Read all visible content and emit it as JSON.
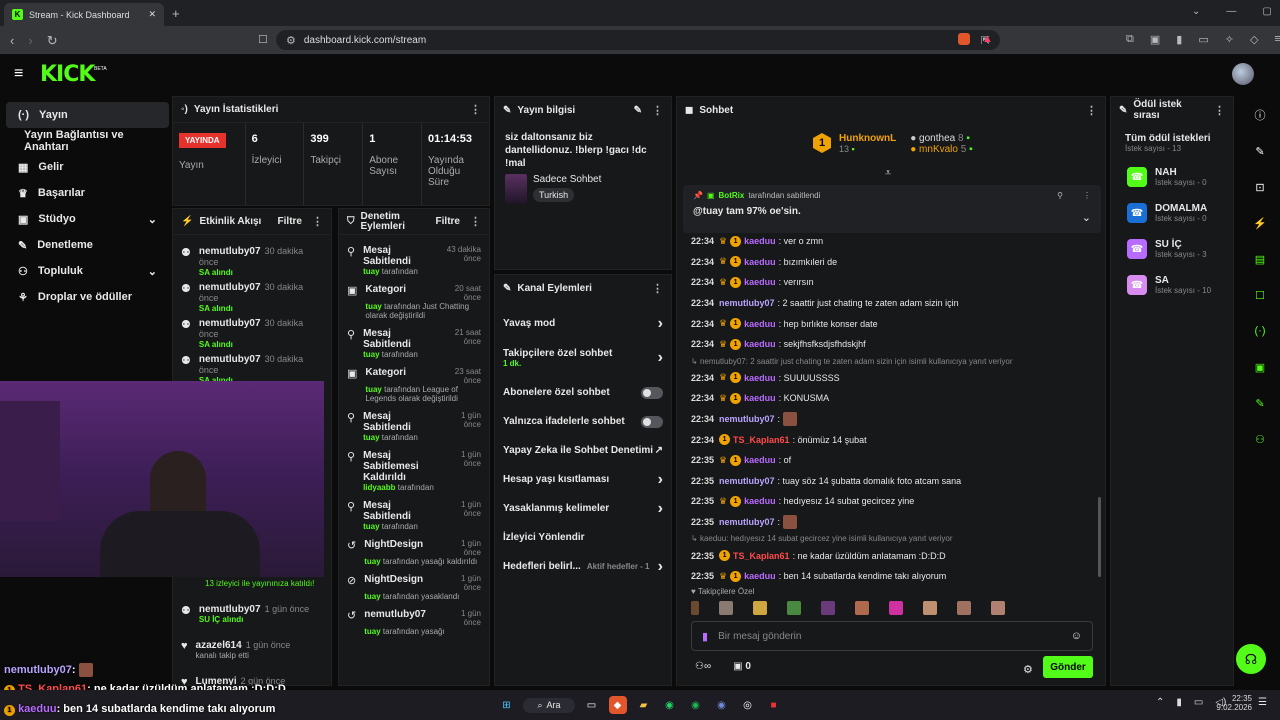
{
  "browser": {
    "tab_title": "Stream - Kick Dashboard",
    "url": "dashboard.kick.com/stream"
  },
  "sidebar": {
    "items": [
      {
        "label": "Yayın",
        "icon": "stream-icon"
      },
      {
        "label": "Yayın Bağlantısı ve Anahtarı",
        "icon": ""
      },
      {
        "label": "Gelir",
        "icon": "revenue-icon"
      },
      {
        "label": "Başarılar",
        "icon": "trophy-icon"
      },
      {
        "label": "Stüdyo",
        "icon": "studio-icon"
      },
      {
        "label": "Denetleme",
        "icon": "wrench-icon"
      },
      {
        "label": "Topluluk",
        "icon": "community-icon"
      },
      {
        "label": "Droplar ve ödüller",
        "icon": "drops-icon"
      }
    ]
  },
  "stats": {
    "title": "Yayın İstatistikleri",
    "live_badge": "YAYINDA",
    "live_label": "Yayın",
    "viewers": "6",
    "viewers_label": "İzleyici",
    "followers": "399",
    "followers_label": "Takipçi",
    "subs": "1",
    "subs_label": "Abone Sayısı",
    "uptime": "01:14:53",
    "uptime_label": "Yayında Olduğu Süre"
  },
  "info": {
    "title": "Yayın bilgisi",
    "stream_title": "siz daltonsanız biz dantellidonuz. !blerp !gacı !dc !mal",
    "category": "Sadece Sohbet",
    "language": "Turkish"
  },
  "activity": {
    "title": "Etkinlik Akışı",
    "filter": "Filtre",
    "items": [
      {
        "name": "nemutluby07",
        "time": "30 dakika önce",
        "sub": "SA alındı"
      },
      {
        "name": "nemutluby07",
        "time": "30 dakika önce",
        "sub": "SA alındı"
      },
      {
        "name": "nemutluby07",
        "time": "30 dakika önce",
        "sub": "SA alındı"
      },
      {
        "name": "nemutluby07",
        "time": "30 dakika önce",
        "sub": "SA alındı"
      }
    ],
    "raid_text": "13 izleyici ile yayınınıza katıldı!",
    "items2": [
      {
        "name": "nemutluby07",
        "time": "1 gün önce",
        "sub": "SU İÇ alındı"
      },
      {
        "name": "azazel614",
        "time": "1 gün önce",
        "sub": "kanalı takip etti"
      },
      {
        "name": "Lumenyi",
        "time": "2 gün önce",
        "sub": ""
      }
    ]
  },
  "moderation": {
    "title": "Denetim Eylemleri",
    "filter": "Filtre",
    "items": [
      {
        "title": "Mesaj Sabitlendi",
        "time": "43 dakika önce",
        "by": "tuay",
        "rest": "tarafından"
      },
      {
        "title": "Kategori",
        "time": "20 saat önce",
        "by": "tuay",
        "rest": "tarafından Just Chatting olarak değiştirildi"
      },
      {
        "title": "Mesaj Sabitlendi",
        "time": "21 saat önce",
        "by": "tuay",
        "rest": "tarafından"
      },
      {
        "title": "Kategori",
        "time": "23 saat önce",
        "by": "tuay",
        "rest": "tarafından League of Legends olarak değiştirildi"
      },
      {
        "title": "Mesaj Sabitlendi",
        "time": "1 gün önce",
        "by": "tuay",
        "rest": "tarafından"
      },
      {
        "title": "Mesaj Sabitlemesi Kaldırıldı",
        "time": "1 gün önce",
        "by": "lidyaabb",
        "rest": "tarafından"
      },
      {
        "title": "Mesaj Sabitlendi",
        "time": "1 gün önce",
        "by": "tuay",
        "rest": "tarafından"
      },
      {
        "title": "NightDesign",
        "time": "1 gün önce",
        "by": "tuay",
        "rest": "tarafından yasağı kaldırıldı"
      },
      {
        "title": "NightDesign",
        "time": "1 gün önce",
        "by": "tuay",
        "rest": "tarafından yasaklandı"
      },
      {
        "title": "nemutluby07",
        "time": "1 gün önce",
        "by": "tuay",
        "rest": "tarafından yasağı"
      }
    ]
  },
  "channel": {
    "title": "Kanal Eylemleri",
    "items": [
      {
        "label": "Yavaş mod",
        "type": "chevron"
      },
      {
        "label": "Takipçilere özel sohbet",
        "extra": "1 dk.",
        "type": "chevron"
      },
      {
        "label": "Abonelere özel sohbet",
        "type": "toggle"
      },
      {
        "label": "Yalnızca ifadelerle sohbet",
        "type": "toggle"
      },
      {
        "label": "Yapay Zeka ile Sohbet Denetimi",
        "type": "link"
      },
      {
        "label": "Hesap yaşı kısıtlaması",
        "type": "chevron"
      },
      {
        "label": "Yasaklanmış kelimeler",
        "type": "chevron"
      },
      {
        "label": "İzleyici Yönlendir",
        "type": "none"
      },
      {
        "label": "Hedefleri belirl...",
        "extra": "Aktif hedefler - 1",
        "type": "chevron"
      }
    ]
  },
  "chat": {
    "title": "Sohbet",
    "leaders": [
      {
        "name": "HunknownL",
        "count": "13"
      },
      {
        "name": "gonthea",
        "count": "8"
      },
      {
        "name": "mnKvalo",
        "count": "5"
      }
    ],
    "pinned_by": "BotRix",
    "pinned_rest": "tarafından sabitlendi",
    "pinned_msg": "@tuay tam 97% oe'sin.",
    "messages": [
      {
        "t": "22:34",
        "u": "kaeduu",
        "c": "p",
        "m": ": ver o zmn",
        "b": true
      },
      {
        "t": "22:34",
        "u": "kaeduu",
        "c": "p",
        "m": ": bızımkıleri de",
        "b": true
      },
      {
        "t": "22:34",
        "u": "kaeduu",
        "c": "p",
        "m": ": verırsın",
        "b": true
      },
      {
        "t": "22:34",
        "u": "nemutluby07",
        "c": "b",
        "m": ": 2 saattir just chating te zaten adam sizin için",
        "b": false
      },
      {
        "t": "22:34",
        "u": "kaeduu",
        "c": "p",
        "m": ": hep bırlıkte konser date",
        "b": true
      },
      {
        "t": "22:34",
        "u": "kaeduu",
        "c": "p",
        "m": ": sekjfhsfksdjsfhdskjhf",
        "b": true
      },
      {
        "reply": "nemutluby07: 2 saattir just chating te zaten adam sizin için isimli kullanıcıya yanıt veriyor"
      },
      {
        "t": "22:34",
        "u": "kaeduu",
        "c": "p",
        "m": ": SUUUUSSSS",
        "b": true
      },
      {
        "t": "22:34",
        "u": "kaeduu",
        "c": "p",
        "m": ": KONUSMA",
        "b": true
      },
      {
        "t": "22:34",
        "u": "nemutluby07",
        "c": "b",
        "m": ":",
        "b": false,
        "emote": true
      },
      {
        "t": "22:34",
        "u": "TS_Kaplan61",
        "c": "r",
        "m": ": önümüz 14 şubat",
        "b": true
      },
      {
        "t": "22:35",
        "u": "kaeduu",
        "c": "p",
        "m": ": of",
        "b": true
      },
      {
        "t": "22:35",
        "u": "nemutluby07",
        "c": "b",
        "m": ": tuay söz 14 şubatta domalık foto atcam sana",
        "b": false
      },
      {
        "t": "22:35",
        "u": "kaeduu",
        "c": "p",
        "m": ": hedıyesız 14 subat gecircez yine",
        "b": true
      },
      {
        "t": "22:35",
        "u": "nemutluby07",
        "c": "b",
        "m": ":",
        "b": false,
        "emote": true
      },
      {
        "reply": "kaeduu: hedıyesız 14 subat gecircez yine isimli kullanıcıya yanıt veriyor"
      },
      {
        "t": "22:35",
        "u": "TS_Kaplan61",
        "c": "r",
        "m": ": ne kadar üzüldüm anlatamam :D:D:D",
        "b": true
      },
      {
        "t": "22:35",
        "u": "kaeduu",
        "c": "p",
        "m": ": ben 14 subatlarda kendime takı alıyorum",
        "b": true
      }
    ],
    "followers_only": "Takipçilere Özel",
    "input_placeholder": "Bir mesaj gönderin",
    "points": "0",
    "send": "Gönder"
  },
  "rewards": {
    "title": "Ödül istek sırası",
    "all": "Tüm ödül istekleri",
    "all_count": "İstek sayısı - 13",
    "items": [
      {
        "name": "NAH",
        "count": "İstek sayısı - 0",
        "color": "#53fc18"
      },
      {
        "name": "DOMALMA",
        "count": "İstek sayısı - 0",
        "color": "#1a6fd6"
      },
      {
        "name": "SU İÇ",
        "count": "İstek sayısı - 3",
        "color": "#b86bff"
      },
      {
        "name": "SA",
        "count": "İstek sayısı - 10",
        "color": "#d88cf0"
      }
    ]
  },
  "overlay": [
    {
      "u": "nemutluby07",
      "m": ":",
      "emote": true
    },
    {
      "u": "TS_Kaplan61",
      "m": ": ne kadar üzüldüm anlatamam :D:D:D",
      "c": "r"
    },
    {
      "u": "kaeduu",
      "m": ": ben 14 subatlarda kendime takı alıyorum",
      "c": "p"
    }
  ],
  "taskbar": {
    "search": "Ara",
    "time": "22:35",
    "date": "9.02.2026"
  }
}
